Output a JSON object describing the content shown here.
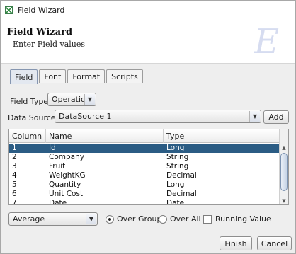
{
  "window": {
    "title": "Field Wizard",
    "icon": "grid-app-icon"
  },
  "banner": {
    "title": "Field Wizard",
    "subtitle": "Enter Field values",
    "logo_glyph": "E"
  },
  "tabs": [
    {
      "label": "Field",
      "active": true
    },
    {
      "label": "Font",
      "active": false
    },
    {
      "label": "Format",
      "active": false
    },
    {
      "label": "Scripts",
      "active": false
    }
  ],
  "field_type": {
    "label": "Field Type:",
    "value": "Operation"
  },
  "data_source": {
    "label": "Data Source:",
    "value": "DataSource 1",
    "add_label": "Add"
  },
  "table": {
    "headers": [
      "Column",
      "Name",
      "Type"
    ],
    "rows": [
      [
        "1",
        "Id",
        "Long"
      ],
      [
        "2",
        "Company",
        "String"
      ],
      [
        "3",
        "Fruit",
        "String"
      ],
      [
        "4",
        "WeightKG",
        "Decimal"
      ],
      [
        "5",
        "Quantity",
        "Long"
      ],
      [
        "6",
        "Unit Cost",
        "Decimal"
      ],
      [
        "7",
        "Date",
        "Date"
      ]
    ],
    "selected_row": 0
  },
  "aggregate": {
    "value": "Average"
  },
  "options": {
    "over_group": {
      "label": "Over Group",
      "checked": true
    },
    "over_all": {
      "label": "Over All",
      "checked": false
    },
    "running_value": {
      "label": "Running Value",
      "checked": false
    }
  },
  "buttons": {
    "finish": "Finish",
    "cancel": "Cancel"
  },
  "colors": {
    "selection": "#2b5c84",
    "active_tab": "#e3e8f0"
  }
}
